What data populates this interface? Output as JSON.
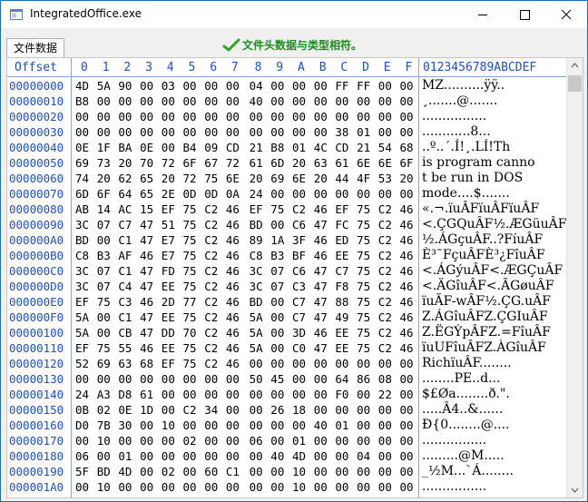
{
  "window": {
    "title": "IntegratedOffice.exe",
    "icons": {
      "app": "app-window-icon",
      "minimize": "minimize-icon",
      "maximize": "maximize-icon",
      "close": "close-icon"
    }
  },
  "tab": {
    "label": "文件数据"
  },
  "status": {
    "text": "文件头数据与类型相符。",
    "icon": "check-icon",
    "color": "#1e8c1e"
  },
  "table": {
    "offset_header": "Offset",
    "hex_headers": [
      "0",
      "1",
      "2",
      "3",
      "4",
      "5",
      "6",
      "7",
      "8",
      "9",
      "A",
      "B",
      "C",
      "D",
      "E",
      "F"
    ],
    "ascii_header": "0123456789ABCDEF",
    "rows": [
      {
        "offset": "00000000",
        "bytes": [
          "4D",
          "5A",
          "90",
          "00",
          "03",
          "00",
          "00",
          "00",
          "04",
          "00",
          "00",
          "00",
          "FF",
          "FF",
          "00",
          "00"
        ],
        "ascii": "MZ..........ÿÿ.."
      },
      {
        "offset": "00000010",
        "bytes": [
          "B8",
          "00",
          "00",
          "00",
          "00",
          "00",
          "00",
          "00",
          "40",
          "00",
          "00",
          "00",
          "00",
          "00",
          "00",
          "00"
        ],
        "ascii": "¸.......@......."
      },
      {
        "offset": "00000020",
        "bytes": [
          "00",
          "00",
          "00",
          "00",
          "00",
          "00",
          "00",
          "00",
          "00",
          "00",
          "00",
          "00",
          "00",
          "00",
          "00",
          "00"
        ],
        "ascii": "................"
      },
      {
        "offset": "00000030",
        "bytes": [
          "00",
          "00",
          "00",
          "00",
          "00",
          "00",
          "00",
          "00",
          "00",
          "00",
          "00",
          "00",
          "38",
          "01",
          "00",
          "00"
        ],
        "ascii": "............8..."
      },
      {
        "offset": "00000040",
        "bytes": [
          "0E",
          "1F",
          "BA",
          "0E",
          "00",
          "B4",
          "09",
          "CD",
          "21",
          "B8",
          "01",
          "4C",
          "CD",
          "21",
          "54",
          "68"
        ],
        "ascii": "..º..´.Í!¸.LÍ!Th"
      },
      {
        "offset": "00000050",
        "bytes": [
          "69",
          "73",
          "20",
          "70",
          "72",
          "6F",
          "67",
          "72",
          "61",
          "6D",
          "20",
          "63",
          "61",
          "6E",
          "6E",
          "6F"
        ],
        "ascii": "is program canno"
      },
      {
        "offset": "00000060",
        "bytes": [
          "74",
          "20",
          "62",
          "65",
          "20",
          "72",
          "75",
          "6E",
          "20",
          "69",
          "6E",
          "20",
          "44",
          "4F",
          "53",
          "20"
        ],
        "ascii": "t be run in DOS "
      },
      {
        "offset": "00000070",
        "bytes": [
          "6D",
          "6F",
          "64",
          "65",
          "2E",
          "0D",
          "0D",
          "0A",
          "24",
          "00",
          "00",
          "00",
          "00",
          "00",
          "00",
          "00"
        ],
        "ascii": "mode....$......."
      },
      {
        "offset": "00000080",
        "bytes": [
          "AB",
          "14",
          "AC",
          "15",
          "EF",
          "75",
          "C2",
          "46",
          "EF",
          "75",
          "C2",
          "46",
          "EF",
          "75",
          "C2",
          "46"
        ],
        "ascii": "«.¬.ïuÂFïuÂFïuÂF"
      },
      {
        "offset": "00000090",
        "bytes": [
          "3C",
          "07",
          "C7",
          "47",
          "51",
          "75",
          "C2",
          "46",
          "BD",
          "00",
          "C6",
          "47",
          "FC",
          "75",
          "C2",
          "46"
        ],
        "ascii": "<.ÇGQuÂF½.ÆGüuÂF"
      },
      {
        "offset": "000000A0",
        "bytes": [
          "BD",
          "00",
          "C1",
          "47",
          "E7",
          "75",
          "C2",
          "46",
          "89",
          "1A",
          "3F",
          "46",
          "ED",
          "75",
          "C2",
          "46"
        ],
        "ascii": "½.ÁGçuÂF..?FíuÂF"
      },
      {
        "offset": "000000B0",
        "bytes": [
          "C8",
          "B3",
          "AF",
          "46",
          "E7",
          "75",
          "C2",
          "46",
          "C8",
          "B3",
          "BF",
          "46",
          "EE",
          "75",
          "C2",
          "46"
        ],
        "ascii": "È³¯FçuÂFÈ³¿FîuÂF"
      },
      {
        "offset": "000000C0",
        "bytes": [
          "3C",
          "07",
          "C1",
          "47",
          "FD",
          "75",
          "C2",
          "46",
          "3C",
          "07",
          "C6",
          "47",
          "C7",
          "75",
          "C2",
          "46"
        ],
        "ascii": "<.ÁGýuÂF<.ÆGÇuÂF"
      },
      {
        "offset": "000000D0",
        "bytes": [
          "3C",
          "07",
          "C4",
          "47",
          "EE",
          "75",
          "C2",
          "46",
          "3C",
          "07",
          "C3",
          "47",
          "F8",
          "75",
          "C2",
          "46"
        ],
        "ascii": "<.ÄGîuÂF<.ÃGøuÂF"
      },
      {
        "offset": "000000E0",
        "bytes": [
          "EF",
          "75",
          "C3",
          "46",
          "2D",
          "77",
          "C2",
          "46",
          "BD",
          "00",
          "C7",
          "47",
          "88",
          "75",
          "C2",
          "46"
        ],
        "ascii": "ïuÃF-wÂF½.ÇG.uÂF"
      },
      {
        "offset": "000000F0",
        "bytes": [
          "5A",
          "00",
          "C1",
          "47",
          "EE",
          "75",
          "C2",
          "46",
          "5A",
          "00",
          "C7",
          "47",
          "49",
          "75",
          "C2",
          "46"
        ],
        "ascii": "Z.ÁGîuÂFZ.ÇGIuÂF"
      },
      {
        "offset": "00000100",
        "bytes": [
          "5A",
          "00",
          "CB",
          "47",
          "DD",
          "70",
          "C2",
          "46",
          "5A",
          "00",
          "3D",
          "46",
          "EE",
          "75",
          "C2",
          "46"
        ],
        "ascii": "Z.ËGÝpÂFZ.=FîuÂF"
      },
      {
        "offset": "00000110",
        "bytes": [
          "EF",
          "75",
          "55",
          "46",
          "EE",
          "75",
          "C2",
          "46",
          "5A",
          "00",
          "C0",
          "47",
          "EE",
          "75",
          "C2",
          "46"
        ],
        "ascii": "ïuUFîuÂFZ.ÀGîuÂF"
      },
      {
        "offset": "00000120",
        "bytes": [
          "52",
          "69",
          "63",
          "68",
          "EF",
          "75",
          "C2",
          "46",
          "00",
          "00",
          "00",
          "00",
          "00",
          "00",
          "00",
          "00"
        ],
        "ascii": "RichïuÂF........"
      },
      {
        "offset": "00000130",
        "bytes": [
          "00",
          "00",
          "00",
          "00",
          "00",
          "00",
          "00",
          "00",
          "50",
          "45",
          "00",
          "00",
          "64",
          "86",
          "08",
          "00"
        ],
        "ascii": "........PE..d..."
      },
      {
        "offset": "00000140",
        "bytes": [
          "24",
          "A3",
          "D8",
          "61",
          "00",
          "00",
          "00",
          "00",
          "00",
          "00",
          "00",
          "00",
          "F0",
          "00",
          "22",
          "00"
        ],
        "ascii": "$£Øa........ð.\"."
      },
      {
        "offset": "00000150",
        "bytes": [
          "0B",
          "02",
          "0E",
          "1D",
          "00",
          "C2",
          "34",
          "00",
          "00",
          "26",
          "18",
          "00",
          "00",
          "00",
          "00",
          "00"
        ],
        "ascii": ".....Â4..&......"
      },
      {
        "offset": "00000160",
        "bytes": [
          "D0",
          "7B",
          "30",
          "00",
          "10",
          "00",
          "00",
          "00",
          "00",
          "00",
          "00",
          "40",
          "01",
          "00",
          "00",
          "00"
        ],
        "ascii": "Ð{0........@...."
      },
      {
        "offset": "00000170",
        "bytes": [
          "00",
          "10",
          "00",
          "00",
          "00",
          "02",
          "00",
          "00",
          "06",
          "00",
          "01",
          "00",
          "00",
          "00",
          "00",
          "00"
        ],
        "ascii": "................"
      },
      {
        "offset": "00000180",
        "bytes": [
          "06",
          "00",
          "01",
          "00",
          "00",
          "00",
          "00",
          "00",
          "00",
          "40",
          "4D",
          "00",
          "00",
          "04",
          "00",
          "00"
        ],
        "ascii": ".........@M....."
      },
      {
        "offset": "00000190",
        "bytes": [
          "5F",
          "BD",
          "4D",
          "00",
          "02",
          "00",
          "60",
          "C1",
          "00",
          "00",
          "10",
          "00",
          "00",
          "00",
          "00",
          "00"
        ],
        "ascii": "_½M...`Á........"
      },
      {
        "offset": "000001A0",
        "bytes": [
          "00",
          "10",
          "00",
          "00",
          "00",
          "00",
          "00",
          "00",
          "00",
          "00",
          "10",
          "00",
          "00",
          "00",
          "00",
          "00"
        ],
        "ascii": "................"
      }
    ]
  }
}
